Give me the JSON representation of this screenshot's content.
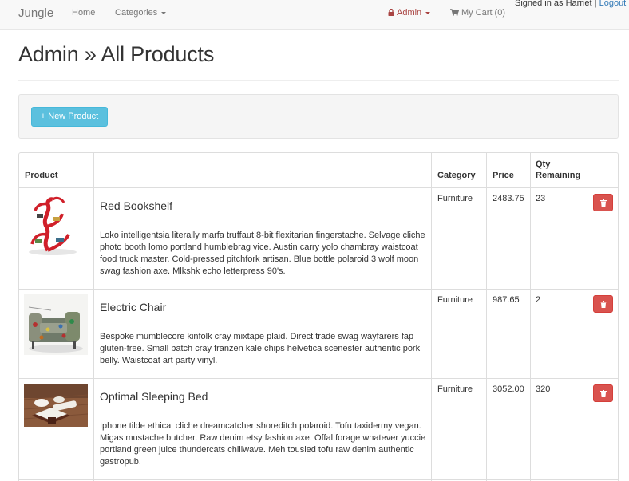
{
  "navbar": {
    "brand": "Jungle",
    "home": "Home",
    "categories": "Categories",
    "admin": "Admin",
    "cart": "My Cart (0)",
    "signed_in": "Signed in as Harriet",
    "separator": "|",
    "logout": "Logout"
  },
  "page": {
    "title": "Admin » All Products"
  },
  "toolbar": {
    "new_product": "+ New Product"
  },
  "table": {
    "headers": {
      "product": "Product",
      "category": "Category",
      "price": "Price",
      "qty_line1": "Qty",
      "qty_line2": "Remaining"
    },
    "rows": [
      {
        "name": "Red Bookshelf",
        "description": "Loko intelligentsia literally marfa truffaut 8-bit flexitarian fingerstache. Selvage cliche photo booth lomo portland humblebrag vice. Austin carry yolo chambray waistcoat food truck master. Cold-pressed pitchfork artisan. Blue bottle polaroid 3 wolf moon swag fashion axe. Mlkshk echo letterpress 90's.",
        "category": "Furniture",
        "price": "2483.75",
        "qty": "23"
      },
      {
        "name": "Electric Chair",
        "description": "Bespoke mumblecore kinfolk cray mixtape plaid. Direct trade swag wayfarers fap gluten-free. Small batch cray franzen kale chips helvetica scenester authentic pork belly. Waistcoat art party vinyl.",
        "category": "Furniture",
        "price": "987.65",
        "qty": "2"
      },
      {
        "name": "Optimal Sleeping Bed",
        "description": "Iphone tilde ethical cliche dreamcatcher shoreditch polaroid. Tofu taxidermy vegan. Migas mustache butcher. Raw denim etsy fashion axe. Offal forage whatever yuccie portland green juice thundercats chillwave. Meh tousled tofu raw denim authentic gastropub.",
        "category": "Furniture",
        "price": "3052.00",
        "qty": "320"
      }
    ]
  },
  "colors": {
    "navbar_bg": "#f8f8f8",
    "admin_red": "#a94442",
    "info_button": "#5bc0de",
    "danger_button": "#d9534f",
    "link_blue": "#337ab7"
  }
}
